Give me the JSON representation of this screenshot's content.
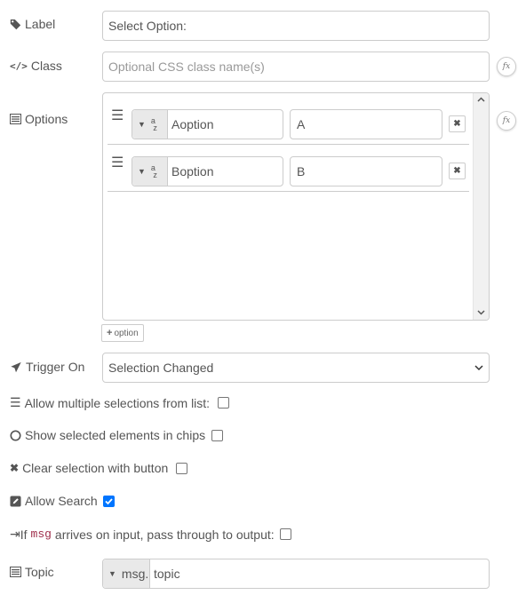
{
  "fields": {
    "label": {
      "label": "Label",
      "value": "Select Option:"
    },
    "class": {
      "label": "Class",
      "placeholder": "Optional CSS class name(s)"
    },
    "options": {
      "label": "Options",
      "items": [
        {
          "type_icon": "a z",
          "label": "Aoption",
          "value": "A"
        },
        {
          "type_icon": "a z",
          "label": "Boption",
          "value": "B"
        }
      ],
      "add_label": "option"
    },
    "trigger": {
      "label": "Trigger On",
      "value": "Selection Changed"
    },
    "multiple": {
      "label": "Allow multiple selections from list:",
      "checked": false
    },
    "chips": {
      "label": "Show selected elements in chips",
      "checked": false
    },
    "clear": {
      "label": "Clear selection with button",
      "checked": false
    },
    "search": {
      "label": "Allow Search",
      "checked": true
    },
    "passthru": {
      "prefix": "If",
      "code": "msg",
      "suffix": "arrives on input, pass through to output:",
      "checked": false
    },
    "topic": {
      "label": "Topic",
      "type": "msg.",
      "value": "topic"
    }
  },
  "fx_label": "fx",
  "colors": {
    "checkbox_on": "#0075ff",
    "code": "#a0304d"
  }
}
